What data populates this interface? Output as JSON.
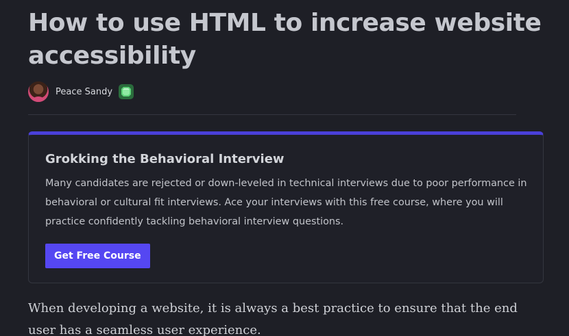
{
  "article": {
    "title": "How to use HTML to increase website accessibility",
    "author": {
      "name": "Peace Sandy",
      "badge_icon": "emerald-gem-icon"
    }
  },
  "promo": {
    "title": "Grokking the Behavioral Interview",
    "description": "Many candidates are rejected or down-leveled in technical interviews due to poor performance in behavioral or cultural fit interviews. Ace your interviews with this free course, where you will practice confidently tackling behavioral interview questions.",
    "button_label": "Get Free Course",
    "accent_color": "#4a40d9",
    "button_color": "#5547f2"
  },
  "body": {
    "intro": "When developing a website, it is always a best practice to ensure that the end user has a seamless user experience."
  }
}
